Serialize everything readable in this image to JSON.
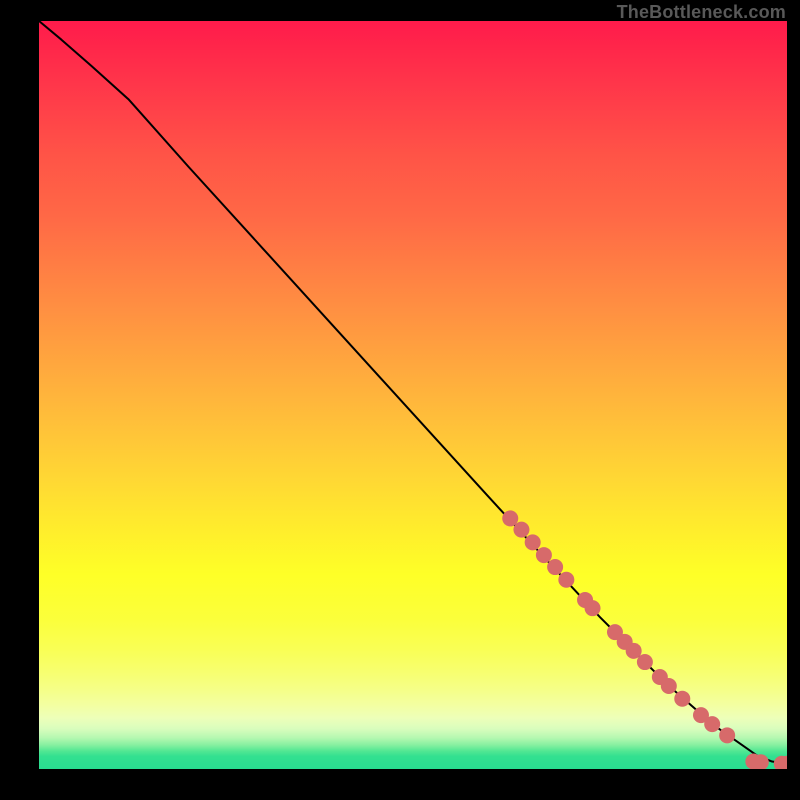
{
  "watermark": "TheBottleneck.com",
  "colors": {
    "line": "#000000",
    "marker_fill": "#d76a6a",
    "marker_edge": "#b94b4b",
    "background_black": "#000000"
  },
  "chart_data": {
    "type": "line",
    "title": "",
    "xlabel": "",
    "ylabel": "",
    "xlim": [
      0,
      100
    ],
    "ylim": [
      0,
      100
    ],
    "axes_visible": false,
    "gradient_background": true,
    "line": {
      "description": "smooth monotone-decreasing curve from top-left to bottom-right with a slight convex flare near the top and flattening at the very bottom right",
      "x": [
        0,
        3,
        7,
        12,
        20,
        30,
        40,
        50,
        60,
        68,
        75,
        80,
        84,
        88,
        91,
        94,
        96,
        98,
        100
      ],
      "y": [
        100,
        97.5,
        94,
        89.5,
        80.5,
        69.5,
        58.5,
        47.5,
        36.5,
        27.8,
        20.3,
        15.3,
        11.3,
        7.8,
        5.3,
        3.2,
        1.8,
        1.0,
        0.7
      ]
    },
    "markers": {
      "description": "clustered salmon-pink circular markers along the lower portion of the line plus a few detached at far bottom-right",
      "points": [
        {
          "x": 63,
          "y": 33.5
        },
        {
          "x": 64.5,
          "y": 32
        },
        {
          "x": 66,
          "y": 30.3
        },
        {
          "x": 67.5,
          "y": 28.6
        },
        {
          "x": 69,
          "y": 27
        },
        {
          "x": 70.5,
          "y": 25.3
        },
        {
          "x": 73,
          "y": 22.6
        },
        {
          "x": 74,
          "y": 21.5
        },
        {
          "x": 77,
          "y": 18.3
        },
        {
          "x": 78.3,
          "y": 17
        },
        {
          "x": 79.5,
          "y": 15.8
        },
        {
          "x": 81,
          "y": 14.3
        },
        {
          "x": 83,
          "y": 12.3
        },
        {
          "x": 84.2,
          "y": 11.1
        },
        {
          "x": 86,
          "y": 9.4
        },
        {
          "x": 88.5,
          "y": 7.2
        },
        {
          "x": 90,
          "y": 6
        },
        {
          "x": 92,
          "y": 4.5
        },
        {
          "x": 95.5,
          "y": 1.0
        },
        {
          "x": 96.5,
          "y": 0.9
        },
        {
          "x": 99.3,
          "y": 0.7
        },
        {
          "x": 100,
          "y": 0.7
        }
      ],
      "radius_px": 8
    }
  }
}
